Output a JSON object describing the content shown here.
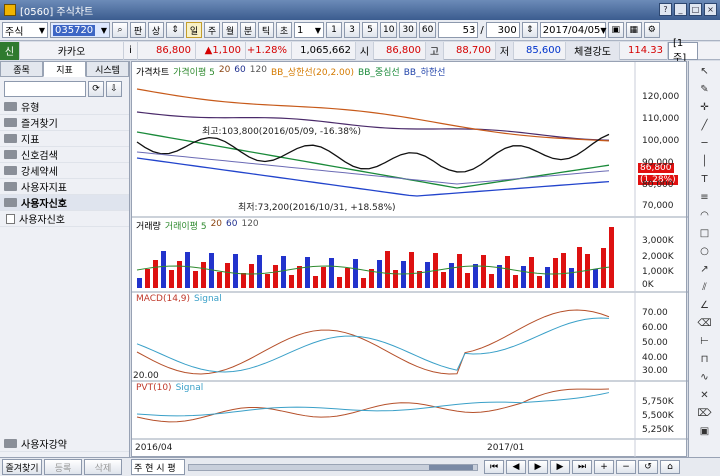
{
  "window": {
    "title": "[0560] 주식차트",
    "window_controls": [
      "?",
      "_",
      "□",
      "×"
    ]
  },
  "toolbar": {
    "market": "주식",
    "code": "035720",
    "btn_pan": "판",
    "btn_sang": "상",
    "period_buttons": [
      "일",
      "주",
      "월",
      "분",
      "틱",
      "초"
    ],
    "period_active": "일",
    "interval": "1",
    "interval_buttons": [
      "1",
      "3",
      "5",
      "10",
      "30",
      "60"
    ],
    "step": "53",
    "step_sep": "/",
    "count": "300",
    "date": "2017/04/05"
  },
  "quote": {
    "label": "신",
    "name": "카카오",
    "info": "i",
    "price": "86,800",
    "change": "▲1,100",
    "rate": "+1.28%",
    "volume": "1,065,662",
    "open_label": "시",
    "open": "86,800",
    "high_label": "고",
    "high": "88,700",
    "low_label": "저",
    "low": "85,600",
    "strength_label": "체결강도",
    "strength": "114.33",
    "unit": "[1주]"
  },
  "left": {
    "tabs": [
      "종목",
      "지표",
      "시스템"
    ],
    "tree": [
      "유형",
      "즐겨찾기",
      "지표",
      "신호검색",
      "강세약세",
      "사용자지표",
      "사용자신호"
    ],
    "sub": "사용자신호",
    "footer": "사용자강약"
  },
  "legends": {
    "price": [
      "가격차트",
      "가격이평 5",
      "20",
      "60",
      "120",
      "BB_상한선(20,2.00)",
      "BB_중심선",
      "BB_하한선"
    ],
    "volume": [
      "거래량",
      "거래이평 5",
      "20",
      "60",
      "120"
    ],
    "macd": [
      "MACD(14,9)",
      "Signal"
    ],
    "pvt": [
      "PVT(10)",
      "Signal"
    ]
  },
  "annotations": {
    "high": "최고:103,800(2016/05/09, -16.38%)",
    "low": "최저:73,200(2016/10/31, +18.58%)",
    "price_box": "86,800",
    "rate_box": "(1.28%)",
    "macd_low": "20.00"
  },
  "axes": {
    "price": [
      "120,000",
      "110,000",
      "100,000",
      "90,000",
      "80,000",
      "70,000"
    ],
    "volume": [
      "3,000K",
      "2,000K",
      "1,000K",
      "0K"
    ],
    "macd": [
      "70.00",
      "60.00",
      "50.00",
      "40.00",
      "30.00"
    ],
    "pvt": [
      "5,750K",
      "5,500K",
      "5,250K"
    ],
    "x": [
      "2016/04",
      "2017/01"
    ]
  },
  "bottom": {
    "tabs": [
      "즐겨찾기",
      "등록",
      "삭제"
    ],
    "mini": "주 현 시 평"
  }
}
